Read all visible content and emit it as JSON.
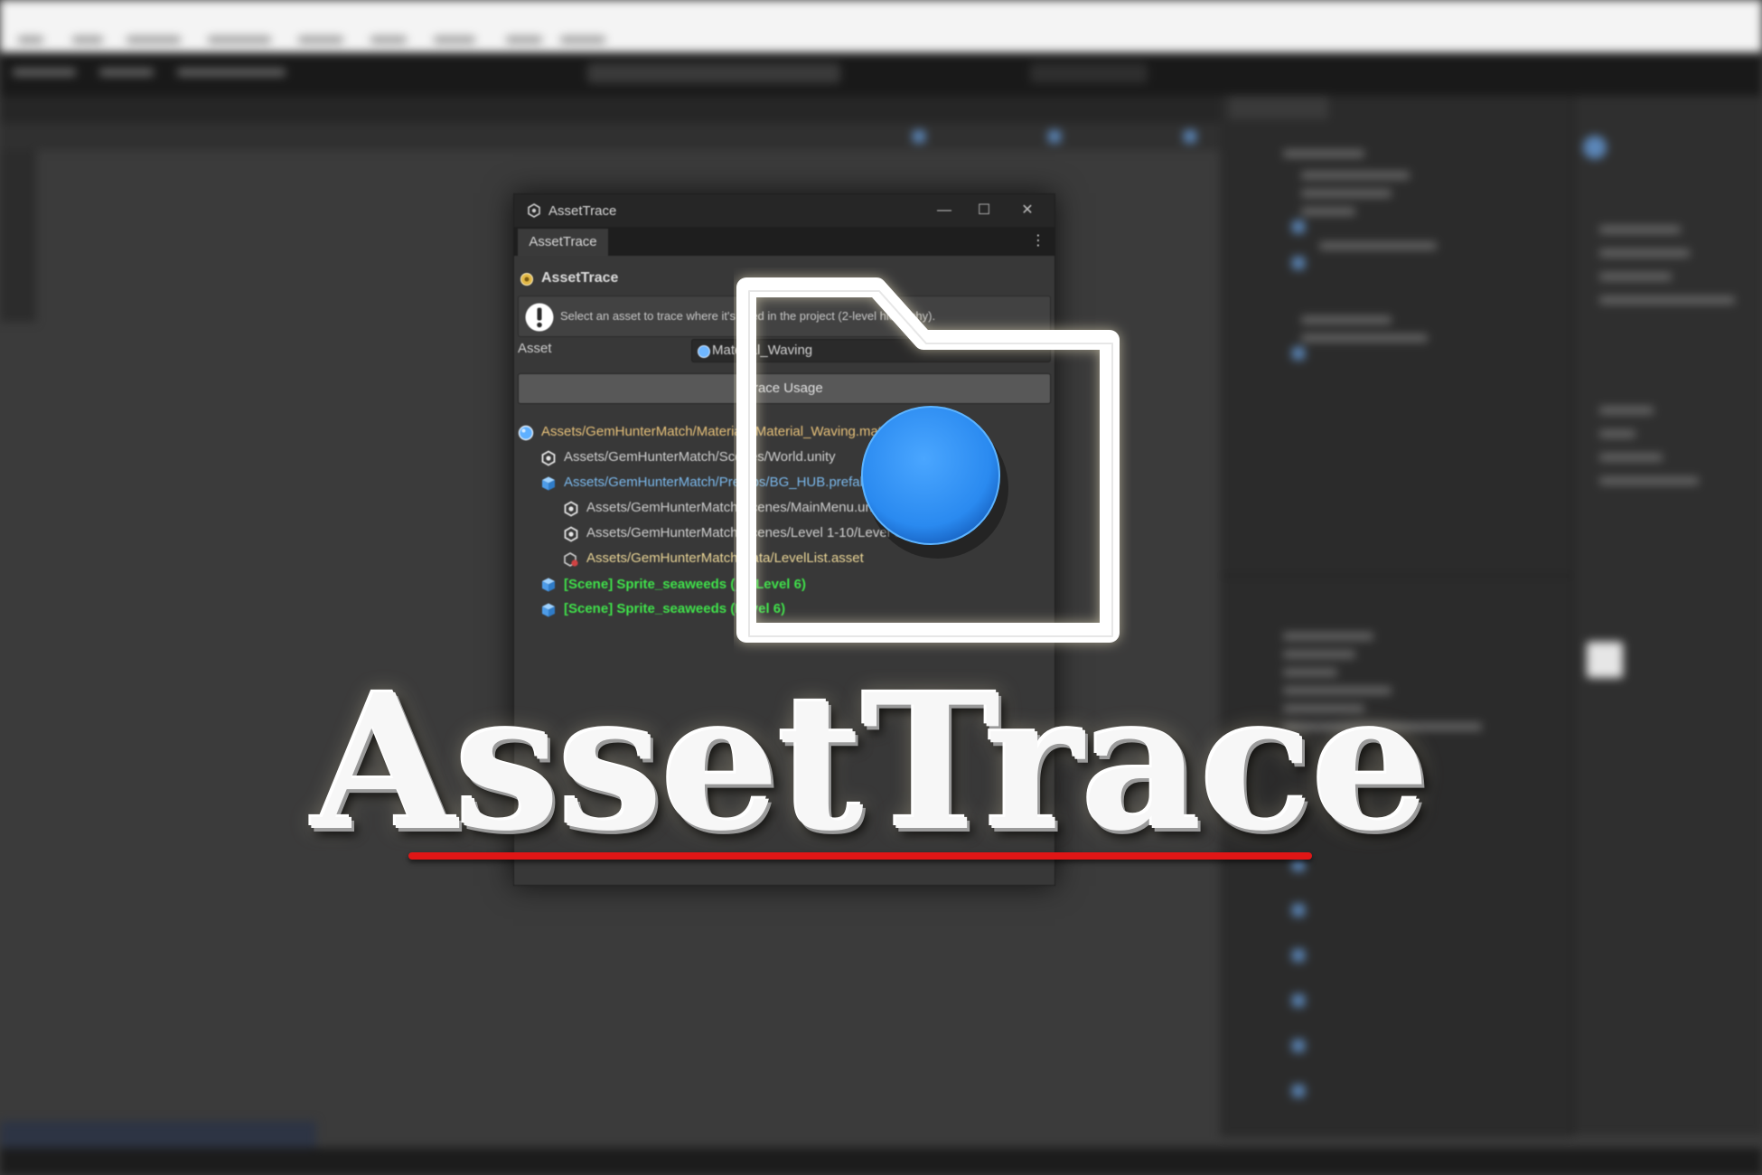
{
  "window": {
    "title": "AssetTrace",
    "tab_label": "AssetTrace",
    "heading": "AssetTrace",
    "help_text": "Select an asset to trace where it's used in the project (2-level hierarchy).",
    "asset_label": "Asset",
    "asset_value": "Material_Waving",
    "trace_button_label": "Trace Usage",
    "controls": {
      "minimize": "—",
      "maximize": "☐",
      "close": "✕",
      "menu": "⋮"
    }
  },
  "tree": [
    {
      "icon": "material-icon",
      "text": "Assets/GemHunterMatch/Materials/Material_Waving.mat",
      "color": "orange",
      "indent": 0
    },
    {
      "icon": "unity-scene-icon",
      "text": "Assets/GemHunterMatch/Scenes/World.unity",
      "color": "grey",
      "indent": 1
    },
    {
      "icon": "prefab-icon",
      "text": "Assets/GemHunterMatch/Prefabs/BG_HUB.prefab",
      "color": "blue",
      "indent": 1
    },
    {
      "icon": "unity-scene-icon",
      "text": "Assets/GemHunterMatch/Scenes/MainMenu.unity",
      "color": "grey",
      "indent": 2
    },
    {
      "icon": "unity-scene-icon",
      "text": "Assets/GemHunterMatch/Scenes/Level 1-10/Level 6.unity",
      "color": "grey",
      "indent": 2
    },
    {
      "icon": "scriptable-object-icon",
      "text": "Assets/GemHunterMatch/Data/LevelList.asset",
      "color": "yellow",
      "indent": 2
    },
    {
      "icon": "prefab-icon",
      "text": "[Scene] Sprite_seaweeds (📌 Level 6)",
      "color": "green",
      "indent": 1
    },
    {
      "icon": "prefab-icon",
      "text": "[Scene] Sprite_seaweeds (Level 6)",
      "color": "green",
      "indent": 1
    }
  ],
  "branding": {
    "title": "AssetTrace",
    "logo_icon": "folder-with-blue-dot-icon",
    "colors": {
      "dot": "#2a8af0",
      "underline": "#e01616",
      "folder_stroke": "#ffffff"
    }
  }
}
